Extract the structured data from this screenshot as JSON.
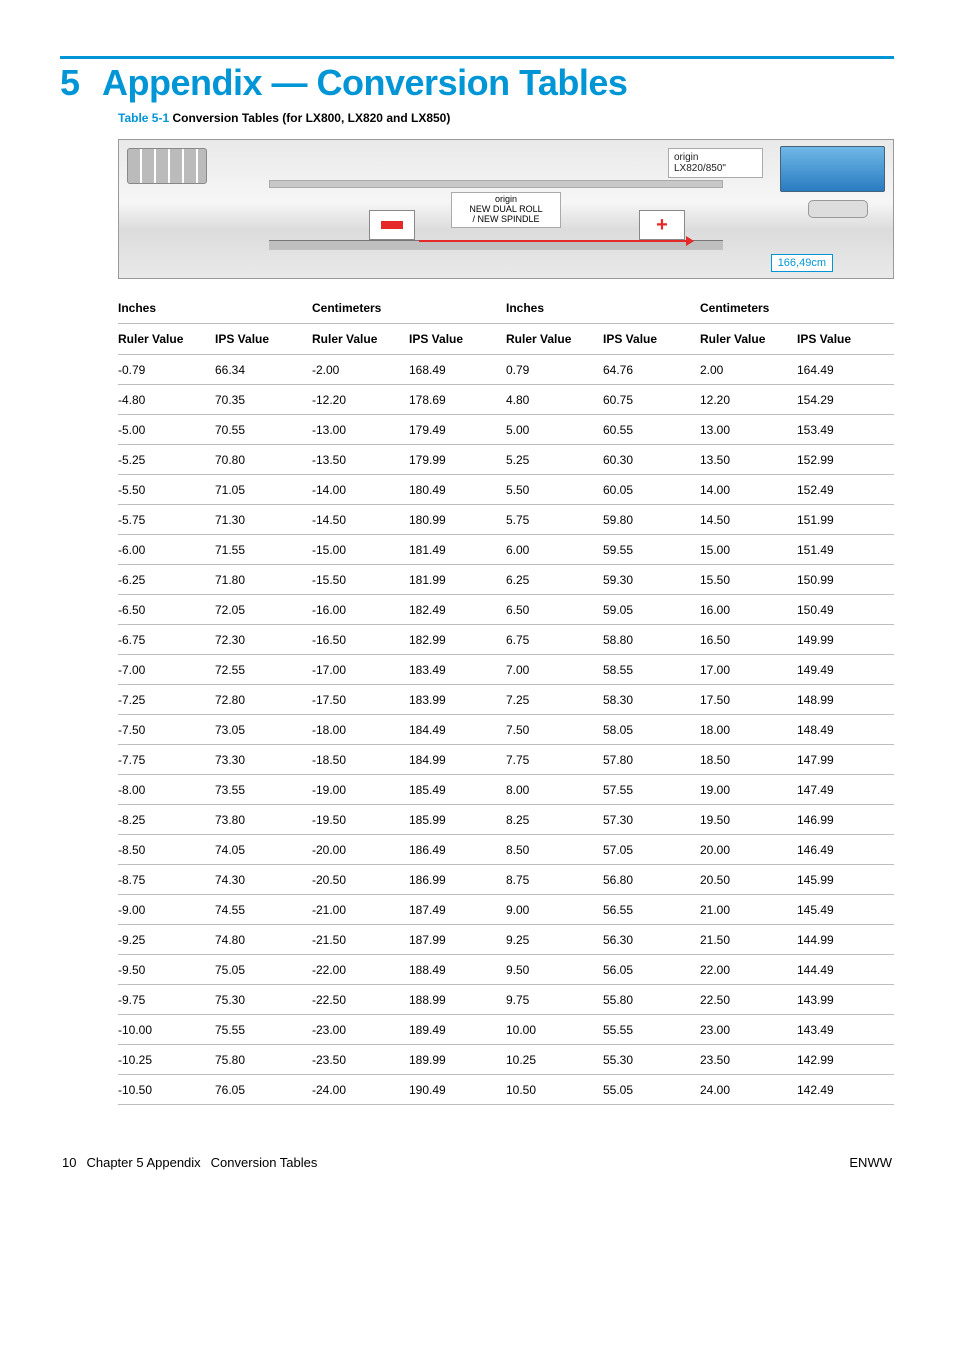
{
  "chapter": {
    "number": "5",
    "title": "Appendix — Conversion Tables"
  },
  "caption": {
    "label": "Table 5-1",
    "text": "  Conversion Tables (for LX800, LX820 and LX850)"
  },
  "diagram": {
    "origin_label_line1": "origin",
    "origin_label_line2": "LX820/850\"",
    "mid_label_line1": "origin",
    "mid_label_line2": "NEW DUAL ROLL",
    "mid_label_line3": "/ NEW SPINDLE",
    "dimension": "166,49cm",
    "cross": "+"
  },
  "headers": {
    "inches": "Inches",
    "centimeters": "Centimeters",
    "ruler_value": "Ruler Value",
    "ips_value": "IPS Value"
  },
  "rows": [
    {
      "a": "-0.79",
      "b": "66.34",
      "c": "-2.00",
      "d": "168.49",
      "e": "0.79",
      "f": "64.76",
      "g": "2.00",
      "h": "164.49"
    },
    {
      "a": "-4.80",
      "b": "70.35",
      "c": "-12.20",
      "d": "178.69",
      "e": "4.80",
      "f": "60.75",
      "g": "12.20",
      "h": "154.29"
    },
    {
      "a": "-5.00",
      "b": "70.55",
      "c": "-13.00",
      "d": "179.49",
      "e": "5.00",
      "f": "60.55",
      "g": "13.00",
      "h": "153.49"
    },
    {
      "a": "-5.25",
      "b": "70.80",
      "c": "-13.50",
      "d": "179.99",
      "e": "5.25",
      "f": "60.30",
      "g": "13.50",
      "h": "152.99"
    },
    {
      "a": "-5.50",
      "b": "71.05",
      "c": "-14.00",
      "d": "180.49",
      "e": "5.50",
      "f": "60.05",
      "g": "14.00",
      "h": "152.49"
    },
    {
      "a": "-5.75",
      "b": "71.30",
      "c": "-14.50",
      "d": "180.99",
      "e": "5.75",
      "f": "59.80",
      "g": "14.50",
      "h": "151.99"
    },
    {
      "a": "-6.00",
      "b": "71.55",
      "c": "-15.00",
      "d": "181.49",
      "e": "6.00",
      "f": "59.55",
      "g": "15.00",
      "h": "151.49"
    },
    {
      "a": "-6.25",
      "b": "71.80",
      "c": "-15.50",
      "d": "181.99",
      "e": "6.25",
      "f": "59.30",
      "g": "15.50",
      "h": "150.99"
    },
    {
      "a": "-6.50",
      "b": "72.05",
      "c": "-16.00",
      "d": "182.49",
      "e": "6.50",
      "f": "59.05",
      "g": "16.00",
      "h": "150.49"
    },
    {
      "a": "-6.75",
      "b": "72.30",
      "c": "-16.50",
      "d": "182.99",
      "e": "6.75",
      "f": "58.80",
      "g": "16.50",
      "h": "149.99"
    },
    {
      "a": "-7.00",
      "b": "72.55",
      "c": "-17.00",
      "d": "183.49",
      "e": "7.00",
      "f": "58.55",
      "g": "17.00",
      "h": "149.49"
    },
    {
      "a": "-7.25",
      "b": "72.80",
      "c": "-17.50",
      "d": "183.99",
      "e": "7.25",
      "f": "58.30",
      "g": "17.50",
      "h": "148.99"
    },
    {
      "a": "-7.50",
      "b": "73.05",
      "c": "-18.00",
      "d": "184.49",
      "e": "7.50",
      "f": "58.05",
      "g": "18.00",
      "h": "148.49"
    },
    {
      "a": "-7.75",
      "b": "73.30",
      "c": "-18.50",
      "d": "184.99",
      "e": "7.75",
      "f": "57.80",
      "g": "18.50",
      "h": "147.99"
    },
    {
      "a": "-8.00",
      "b": "73.55",
      "c": "-19.00",
      "d": "185.49",
      "e": "8.00",
      "f": "57.55",
      "g": "19.00",
      "h": "147.49"
    },
    {
      "a": "-8.25",
      "b": "73.80",
      "c": "-19.50",
      "d": "185.99",
      "e": "8.25",
      "f": "57.30",
      "g": "19.50",
      "h": "146.99"
    },
    {
      "a": "-8.50",
      "b": "74.05",
      "c": "-20.00",
      "d": "186.49",
      "e": "8.50",
      "f": "57.05",
      "g": "20.00",
      "h": "146.49"
    },
    {
      "a": "-8.75",
      "b": "74.30",
      "c": "-20.50",
      "d": "186.99",
      "e": "8.75",
      "f": "56.80",
      "g": "20.50",
      "h": "145.99"
    },
    {
      "a": "-9.00",
      "b": "74.55",
      "c": "-21.00",
      "d": "187.49",
      "e": "9.00",
      "f": "56.55",
      "g": "21.00",
      "h": "145.49"
    },
    {
      "a": "-9.25",
      "b": "74.80",
      "c": "-21.50",
      "d": "187.99",
      "e": "9.25",
      "f": "56.30",
      "g": "21.50",
      "h": "144.99"
    },
    {
      "a": "-9.50",
      "b": "75.05",
      "c": "-22.00",
      "d": "188.49",
      "e": "9.50",
      "f": "56.05",
      "g": "22.00",
      "h": "144.49"
    },
    {
      "a": "-9.75",
      "b": "75.30",
      "c": "-22.50",
      "d": "188.99",
      "e": "9.75",
      "f": "55.80",
      "g": "22.50",
      "h": "143.99"
    },
    {
      "a": "-10.00",
      "b": "75.55",
      "c": "-23.00",
      "d": "189.49",
      "e": "10.00",
      "f": "55.55",
      "g": "23.00",
      "h": "143.49"
    },
    {
      "a": "-10.25",
      "b": "75.80",
      "c": "-23.50",
      "d": "189.99",
      "e": "10.25",
      "f": "55.30",
      "g": "23.50",
      "h": "142.99"
    },
    {
      "a": "-10.50",
      "b": "76.05",
      "c": "-24.00",
      "d": "190.49",
      "e": "10.50",
      "f": "55.05",
      "g": "24.00",
      "h": "142.49"
    }
  ],
  "footer": {
    "page_num": "10",
    "chapter_label": "Chapter 5  Appendix",
    "section_label": "Conversion Tables",
    "right": "ENWW"
  }
}
